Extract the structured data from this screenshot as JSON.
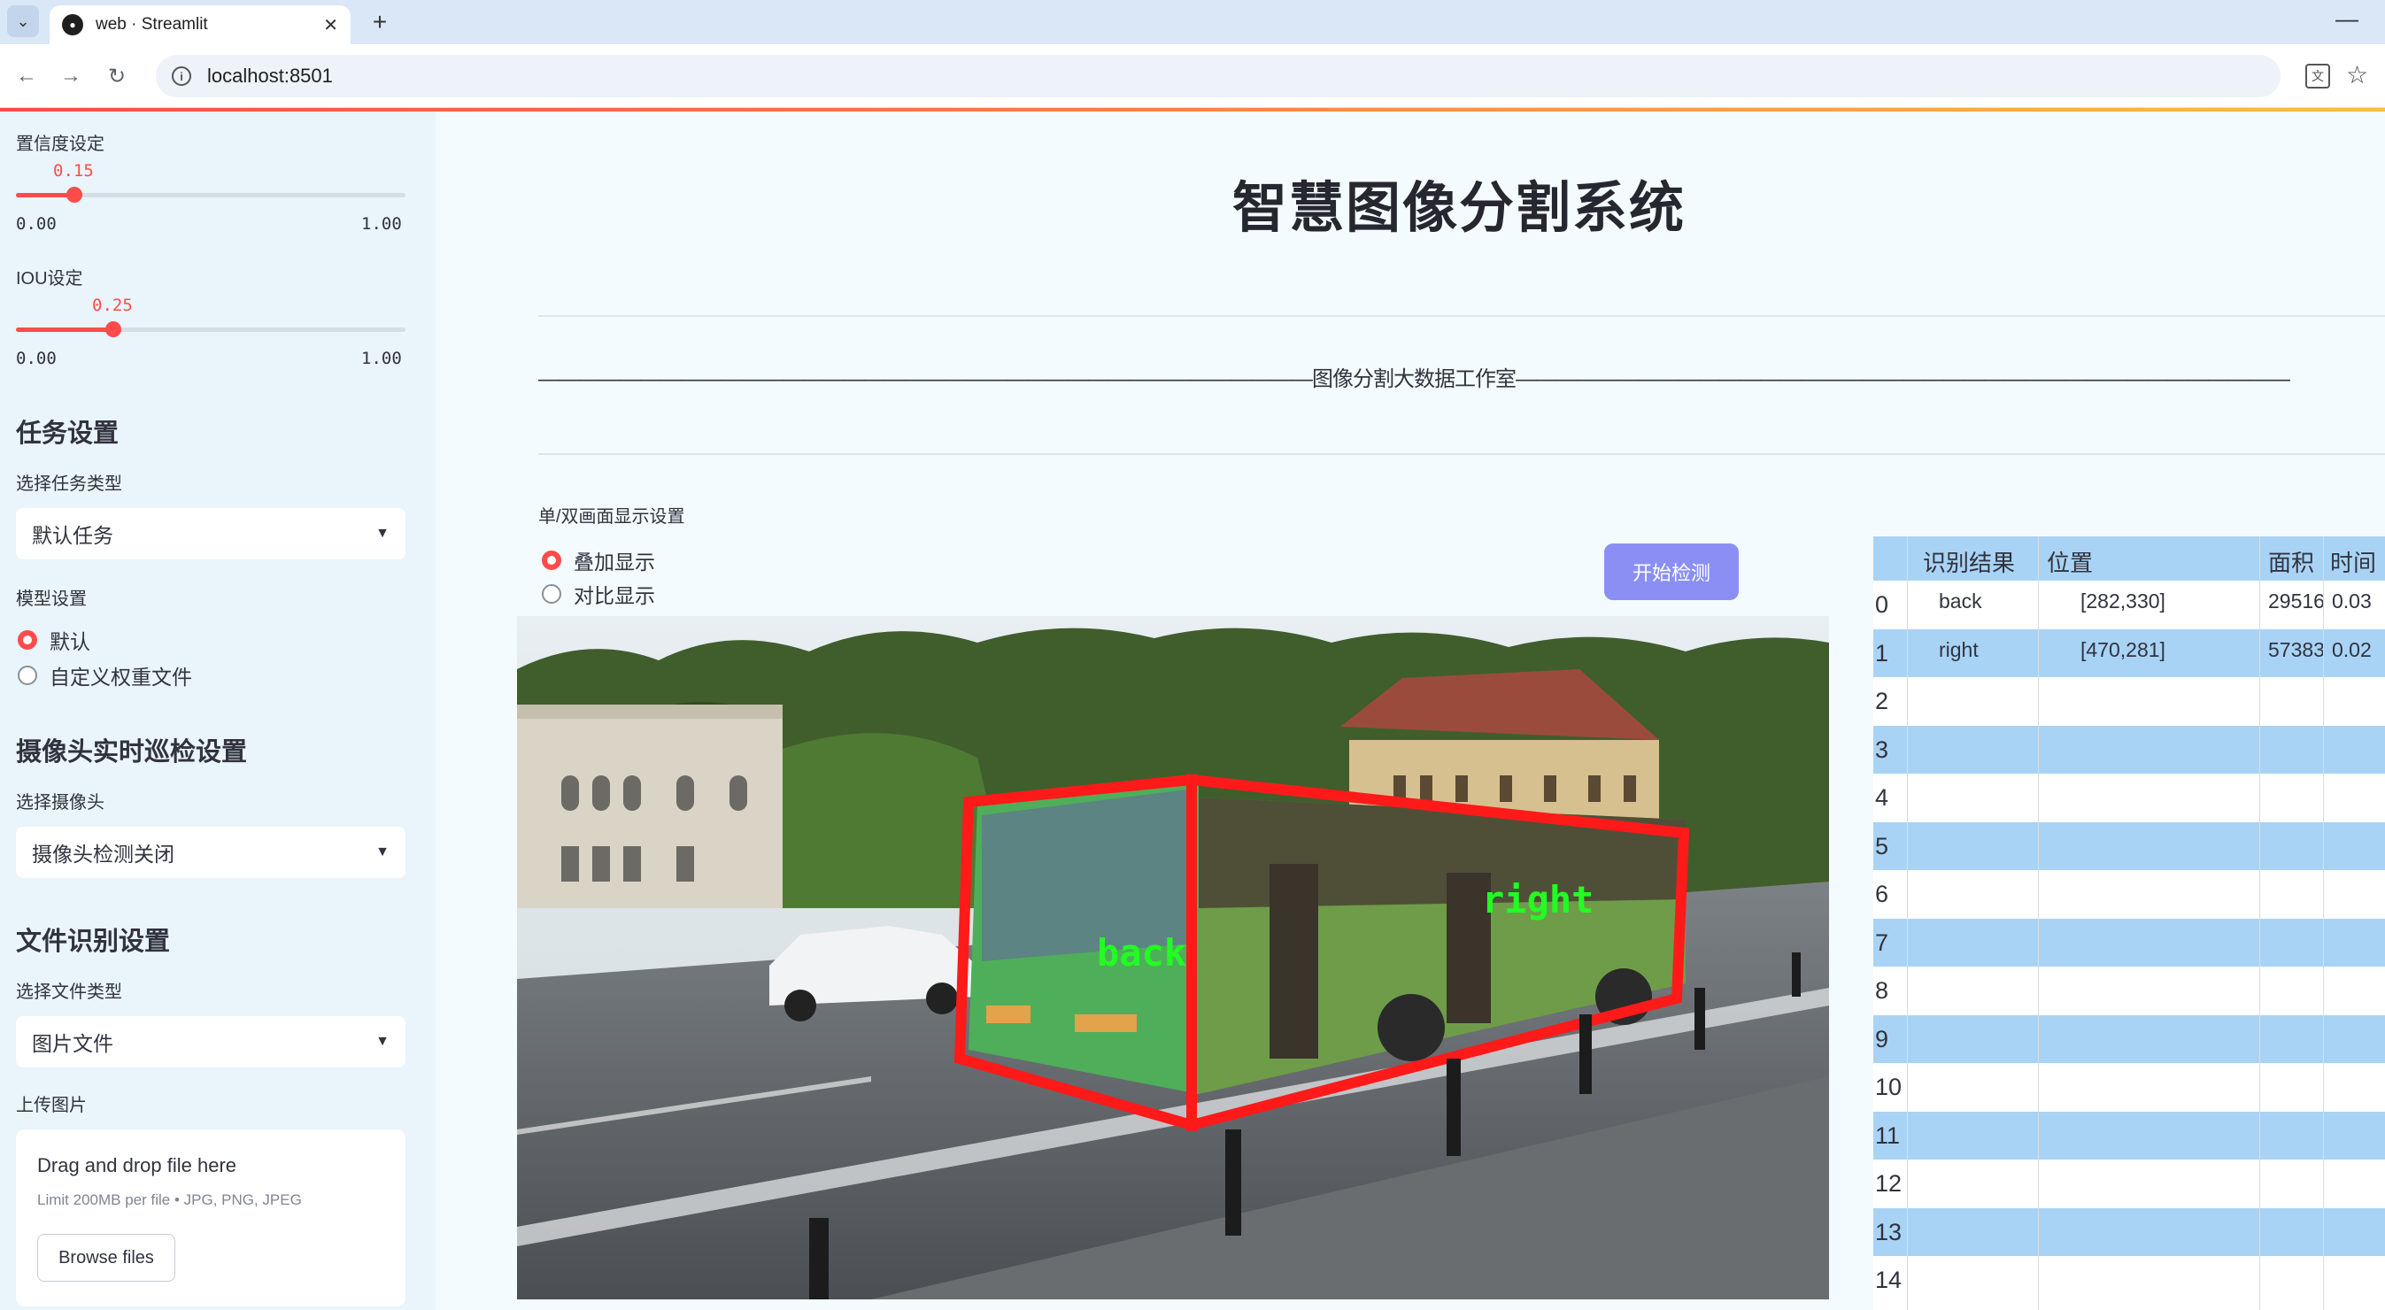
{
  "browser": {
    "tab_title": "web · Streamlit",
    "url": "localhost:8501"
  },
  "sidebar": {
    "confidence": {
      "label": "置信度设定",
      "value": "0.15",
      "min": "0.00",
      "max": "1.00",
      "fraction": 0.15
    },
    "iou": {
      "label": "IOU设定",
      "value": "0.25",
      "min": "0.00",
      "max": "1.00",
      "fraction": 0.25
    },
    "task_heading": "任务设置",
    "task_type_label": "选择任务类型",
    "task_type_value": "默认任务",
    "model_label": "模型设置",
    "model_options": [
      "默认",
      "自定义权重文件"
    ],
    "model_selected": 0,
    "camera_heading": "摄像头实时巡检设置",
    "camera_label": "选择摄像头",
    "camera_value": "摄像头检测关闭",
    "file_heading": "文件识别设置",
    "file_type_label": "选择文件类型",
    "file_type_value": "图片文件",
    "upload_label": "上传图片",
    "upload_title": "Drag and drop file here",
    "upload_limit": "Limit 200MB per file • JPG, PNG, JPEG",
    "browse_label": "Browse files"
  },
  "main": {
    "title": "智慧图像分割系统",
    "studio_line": "——————————————————————————————————————图像分割大数据工作室——————————————————————————————————————",
    "display_label": "单/双画面显示设置",
    "display_options": [
      "叠加显示",
      "对比显示"
    ],
    "display_selected": 0,
    "detect_button": "开始检测",
    "image_labels": [
      "back",
      "right"
    ]
  },
  "table": {
    "headers": [
      "识别结果",
      "位置",
      "面积",
      "时间"
    ],
    "rows": [
      {
        "idx": "0",
        "result": "back",
        "position": "[282,330]",
        "area": "29516",
        "time": "0.03"
      },
      {
        "idx": "1",
        "result": "right",
        "position": "[470,281]",
        "area": "57383",
        "time": "0.02"
      },
      {
        "idx": "2"
      },
      {
        "idx": "3"
      },
      {
        "idx": "4"
      },
      {
        "idx": "5"
      },
      {
        "idx": "6"
      },
      {
        "idx": "7"
      },
      {
        "idx": "8"
      },
      {
        "idx": "9"
      },
      {
        "idx": "10"
      },
      {
        "idx": "11"
      },
      {
        "idx": "12"
      },
      {
        "idx": "13"
      },
      {
        "idx": "14"
      }
    ]
  },
  "colors": {
    "accent": "#ff4b4b",
    "button": "#8b8ff4",
    "table_stripe": "#a9d3f5",
    "sidebar_bg": "#eaf4fb",
    "detect_box": "#ff1a1a",
    "label_text": "#22ff22"
  },
  "icons": [
    "chevron-down-icon",
    "streamlit-favicon",
    "close-icon",
    "plus-icon",
    "minimize-icon",
    "back-arrow-icon",
    "forward-arrow-icon",
    "reload-icon",
    "info-icon",
    "translate-icon",
    "star-icon",
    "caret-down-icon"
  ]
}
